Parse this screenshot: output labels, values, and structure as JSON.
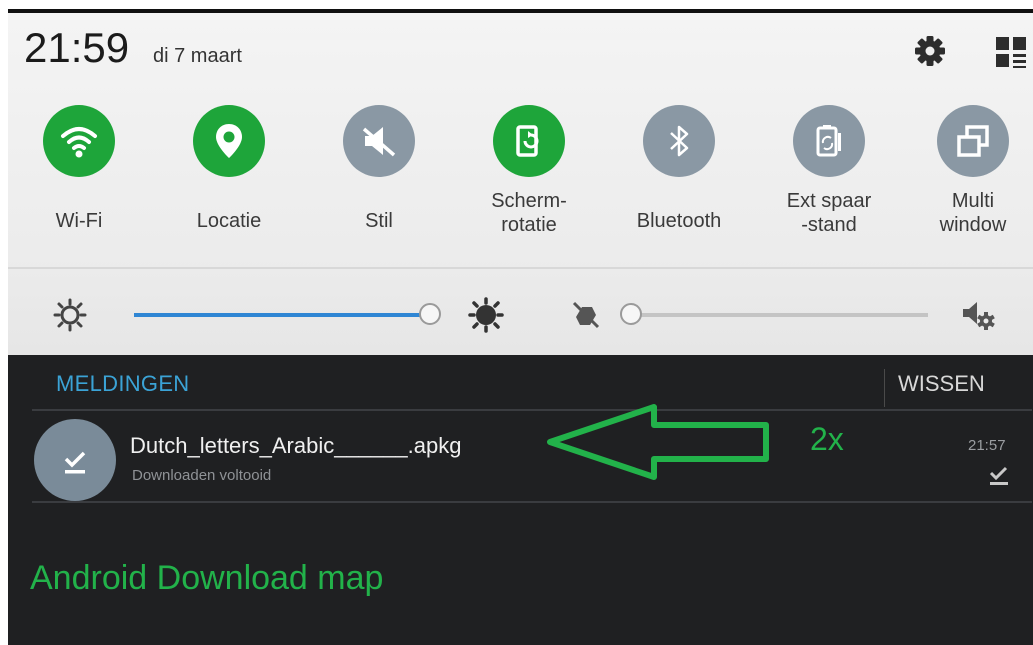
{
  "status": {
    "time": "21:59",
    "date": "di 7 maart"
  },
  "header_icons": {
    "settings": "gear-icon",
    "edit": "grid-edit-icon"
  },
  "toggles": [
    {
      "id": "wifi",
      "label": "Wi-Fi",
      "state": "on",
      "icon": "wifi-icon"
    },
    {
      "id": "location",
      "label": "Locatie",
      "state": "on",
      "icon": "location-pin-icon"
    },
    {
      "id": "silent",
      "label": "Stil",
      "state": "off",
      "icon": "mute-icon"
    },
    {
      "id": "rotation",
      "label": "Scherm-\nrotatie",
      "state": "on",
      "icon": "rotate-screen-icon"
    },
    {
      "id": "bluetooth",
      "label": "Bluetooth",
      "state": "off",
      "icon": "bluetooth-icon"
    },
    {
      "id": "powersave",
      "label": "Ext spaar\n-stand",
      "state": "off",
      "icon": "power-save-icon"
    },
    {
      "id": "multiwindow",
      "label": "Multi\nwindow",
      "state": "off",
      "icon": "multi-window-icon"
    }
  ],
  "brightness": {
    "level": 1.0,
    "min_icon": "sun-dim-icon",
    "max_icon": "sun-bright-icon"
  },
  "volume": {
    "level": 0.0,
    "icon": "vibrate-icon",
    "settings_icon": "volume-settings-icon"
  },
  "notifications": {
    "header": "MELDINGEN",
    "clear": "WISSEN",
    "items": [
      {
        "title": "Dutch_letters_Arabic______.apkg",
        "subtitle": "Downloaden voltooid",
        "time": "21:57",
        "icon": "download-complete-icon"
      }
    ]
  },
  "annotations": {
    "count": "2x",
    "caption": "Android Download map",
    "arrow_color": "#22b24a"
  },
  "colors": {
    "toggle_on": "#1ea53a",
    "toggle_off": "#8a98a4",
    "slider": "#2f86d4",
    "header_blue": "#3ba3d6"
  }
}
